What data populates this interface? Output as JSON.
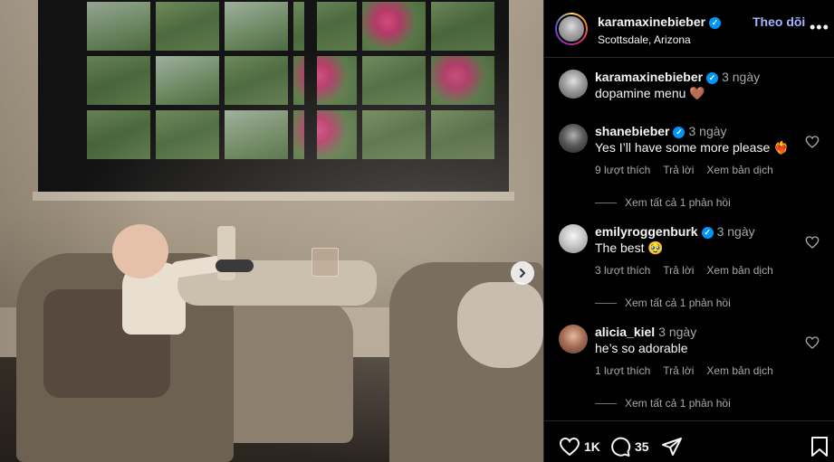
{
  "post": {
    "username": "karamaxinebieber",
    "location": "Scottsdale, Arizona",
    "follow_label": "Theo dõi",
    "caption_time": "3 ngày",
    "caption_text": "dopamine menu 🤎"
  },
  "comments": [
    {
      "username": "shanebieber",
      "time": "3 ngày",
      "text": "Yes I’ll have some more please ❤️‍🔥",
      "likes": "9 lượt thích",
      "reply": "Trả lời",
      "translate": "Xem bản dịch",
      "view_replies": "Xem tất cả 1 phản hồi",
      "verified": true
    },
    {
      "username": "emilyroggenburk",
      "time": "3 ngày",
      "text": "The best 🥹",
      "likes": "3 lượt thích",
      "reply": "Trả lời",
      "translate": "Xem bản dịch",
      "view_replies": "Xem tất cả 1 phản hồi",
      "verified": true
    },
    {
      "username": "alicia_kiel",
      "time": "3 ngày",
      "text": "he’s so adorable",
      "likes": "1 lượt thích",
      "reply": "Trả lời",
      "translate": "Xem bản dịch",
      "view_replies": "Xem tất cả 1 phản hồi",
      "verified": false
    }
  ],
  "actions": {
    "like_count": "1K",
    "comment_count": "35"
  },
  "icons": {
    "verified": "verified-badge-icon",
    "more": "more-options-icon",
    "heart": "heart-icon",
    "comment": "comment-icon",
    "share": "share-icon",
    "save": "bookmark-icon",
    "next": "chevron-right-icon"
  },
  "colors": {
    "follow": "#a9b4ff",
    "verified": "#0095f6",
    "background": "#000000",
    "muted_text": "#a8a8a8"
  }
}
